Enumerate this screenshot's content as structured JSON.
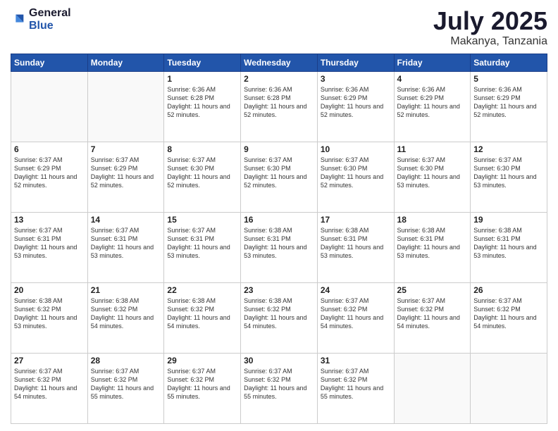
{
  "header": {
    "logo_general": "General",
    "logo_blue": "Blue",
    "title": "July 2025",
    "location": "Makanya, Tanzania"
  },
  "weekdays": [
    "Sunday",
    "Monday",
    "Tuesday",
    "Wednesday",
    "Thursday",
    "Friday",
    "Saturday"
  ],
  "weeks": [
    [
      {
        "day": "",
        "info": ""
      },
      {
        "day": "",
        "info": ""
      },
      {
        "day": "1",
        "info": "Sunrise: 6:36 AM\nSunset: 6:28 PM\nDaylight: 11 hours and 52 minutes."
      },
      {
        "day": "2",
        "info": "Sunrise: 6:36 AM\nSunset: 6:28 PM\nDaylight: 11 hours and 52 minutes."
      },
      {
        "day": "3",
        "info": "Sunrise: 6:36 AM\nSunset: 6:29 PM\nDaylight: 11 hours and 52 minutes."
      },
      {
        "day": "4",
        "info": "Sunrise: 6:36 AM\nSunset: 6:29 PM\nDaylight: 11 hours and 52 minutes."
      },
      {
        "day": "5",
        "info": "Sunrise: 6:36 AM\nSunset: 6:29 PM\nDaylight: 11 hours and 52 minutes."
      }
    ],
    [
      {
        "day": "6",
        "info": "Sunrise: 6:37 AM\nSunset: 6:29 PM\nDaylight: 11 hours and 52 minutes."
      },
      {
        "day": "7",
        "info": "Sunrise: 6:37 AM\nSunset: 6:29 PM\nDaylight: 11 hours and 52 minutes."
      },
      {
        "day": "8",
        "info": "Sunrise: 6:37 AM\nSunset: 6:30 PM\nDaylight: 11 hours and 52 minutes."
      },
      {
        "day": "9",
        "info": "Sunrise: 6:37 AM\nSunset: 6:30 PM\nDaylight: 11 hours and 52 minutes."
      },
      {
        "day": "10",
        "info": "Sunrise: 6:37 AM\nSunset: 6:30 PM\nDaylight: 11 hours and 52 minutes."
      },
      {
        "day": "11",
        "info": "Sunrise: 6:37 AM\nSunset: 6:30 PM\nDaylight: 11 hours and 53 minutes."
      },
      {
        "day": "12",
        "info": "Sunrise: 6:37 AM\nSunset: 6:30 PM\nDaylight: 11 hours and 53 minutes."
      }
    ],
    [
      {
        "day": "13",
        "info": "Sunrise: 6:37 AM\nSunset: 6:31 PM\nDaylight: 11 hours and 53 minutes."
      },
      {
        "day": "14",
        "info": "Sunrise: 6:37 AM\nSunset: 6:31 PM\nDaylight: 11 hours and 53 minutes."
      },
      {
        "day": "15",
        "info": "Sunrise: 6:37 AM\nSunset: 6:31 PM\nDaylight: 11 hours and 53 minutes."
      },
      {
        "day": "16",
        "info": "Sunrise: 6:38 AM\nSunset: 6:31 PM\nDaylight: 11 hours and 53 minutes."
      },
      {
        "day": "17",
        "info": "Sunrise: 6:38 AM\nSunset: 6:31 PM\nDaylight: 11 hours and 53 minutes."
      },
      {
        "day": "18",
        "info": "Sunrise: 6:38 AM\nSunset: 6:31 PM\nDaylight: 11 hours and 53 minutes."
      },
      {
        "day": "19",
        "info": "Sunrise: 6:38 AM\nSunset: 6:31 PM\nDaylight: 11 hours and 53 minutes."
      }
    ],
    [
      {
        "day": "20",
        "info": "Sunrise: 6:38 AM\nSunset: 6:32 PM\nDaylight: 11 hours and 53 minutes."
      },
      {
        "day": "21",
        "info": "Sunrise: 6:38 AM\nSunset: 6:32 PM\nDaylight: 11 hours and 54 minutes."
      },
      {
        "day": "22",
        "info": "Sunrise: 6:38 AM\nSunset: 6:32 PM\nDaylight: 11 hours and 54 minutes."
      },
      {
        "day": "23",
        "info": "Sunrise: 6:38 AM\nSunset: 6:32 PM\nDaylight: 11 hours and 54 minutes."
      },
      {
        "day": "24",
        "info": "Sunrise: 6:37 AM\nSunset: 6:32 PM\nDaylight: 11 hours and 54 minutes."
      },
      {
        "day": "25",
        "info": "Sunrise: 6:37 AM\nSunset: 6:32 PM\nDaylight: 11 hours and 54 minutes."
      },
      {
        "day": "26",
        "info": "Sunrise: 6:37 AM\nSunset: 6:32 PM\nDaylight: 11 hours and 54 minutes."
      }
    ],
    [
      {
        "day": "27",
        "info": "Sunrise: 6:37 AM\nSunset: 6:32 PM\nDaylight: 11 hours and 54 minutes."
      },
      {
        "day": "28",
        "info": "Sunrise: 6:37 AM\nSunset: 6:32 PM\nDaylight: 11 hours and 55 minutes."
      },
      {
        "day": "29",
        "info": "Sunrise: 6:37 AM\nSunset: 6:32 PM\nDaylight: 11 hours and 55 minutes."
      },
      {
        "day": "30",
        "info": "Sunrise: 6:37 AM\nSunset: 6:32 PM\nDaylight: 11 hours and 55 minutes."
      },
      {
        "day": "31",
        "info": "Sunrise: 6:37 AM\nSunset: 6:32 PM\nDaylight: 11 hours and 55 minutes."
      },
      {
        "day": "",
        "info": ""
      },
      {
        "day": "",
        "info": ""
      }
    ]
  ]
}
